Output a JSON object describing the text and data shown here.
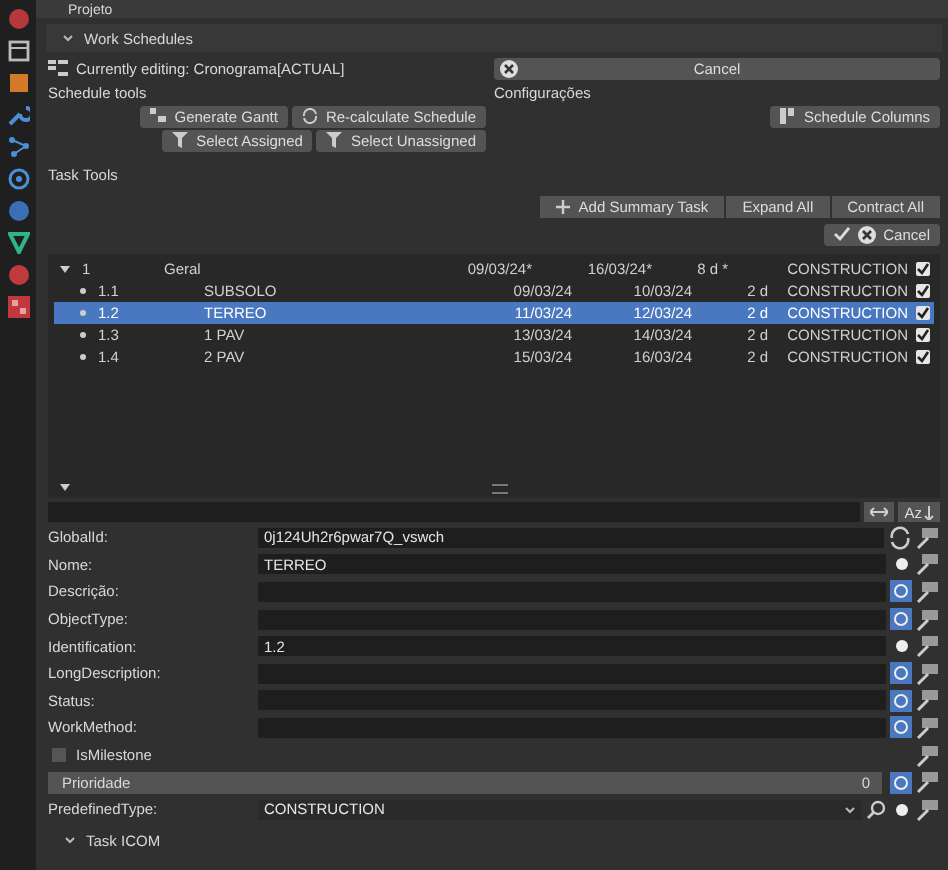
{
  "panel": {
    "title": "Projeto"
  },
  "work_schedules": {
    "title": "Work Schedules",
    "expanded": true,
    "editing": "Currently editing: Cronograma[ACTUAL]",
    "cancel": "Cancel",
    "schedule_tools_label": "Schedule tools",
    "settings_label": "Configurações",
    "tool_buttons": [
      "Generate Gantt",
      "Re-calculate Schedule"
    ],
    "select_buttons": [
      "Select Assigned",
      "Select Unassigned"
    ],
    "schedule_columns": "Schedule Columns",
    "task_tools_label": "Task Tools",
    "task_buttons": [
      "Add Summary Task",
      "Expand All",
      "Contract All"
    ],
    "task_cancel": "Cancel"
  },
  "tasks": [
    {
      "id": "1",
      "name": "Geral",
      "start": "09/03/24*",
      "finish": "16/03/24*",
      "duration": "8 d *",
      "type": "CONSTRUCTION",
      "checked": true,
      "expanded": true,
      "selected": false,
      "children": [
        {
          "id": "1.1",
          "name": "SUBSOLO",
          "start": "09/03/24",
          "finish": "10/03/24",
          "duration": "2 d",
          "type": "CONSTRUCTION",
          "checked": true,
          "selected": false
        },
        {
          "id": "1.2",
          "name": "TERREO",
          "start": "11/03/24",
          "finish": "12/03/24",
          "duration": "2 d",
          "type": "CONSTRUCTION",
          "checked": true,
          "selected": true
        },
        {
          "id": "1.3",
          "name": "1 PAV",
          "start": "13/03/24",
          "finish": "14/03/24",
          "duration": "2 d",
          "type": "CONSTRUCTION",
          "checked": true,
          "selected": false
        },
        {
          "id": "1.4",
          "name": "2 PAV",
          "start": "15/03/24",
          "finish": "16/03/24",
          "duration": "2 d",
          "type": "CONSTRUCTION",
          "checked": true,
          "selected": false
        }
      ]
    }
  ],
  "sort_label": "Az",
  "attributes": [
    {
      "kind": "regenerate",
      "label": "GlobalId:",
      "value": "0j124Uh2r6pwar7Q_vswch"
    },
    {
      "kind": "text",
      "label": "Nome:",
      "value": "TERREO",
      "is_null": false
    },
    {
      "kind": "text",
      "label": "Descrição:",
      "is_null": true
    },
    {
      "kind": "text",
      "label": "ObjectType:",
      "is_null": true
    },
    {
      "kind": "text",
      "label": "Identification:",
      "value": "1.2",
      "is_null": false
    },
    {
      "kind": "text",
      "label": "LongDescription:",
      "is_null": true
    },
    {
      "kind": "text",
      "label": "Status:",
      "is_null": true
    },
    {
      "kind": "text",
      "label": "WorkMethod:",
      "is_null": true
    },
    {
      "kind": "checkbox",
      "label": "IsMilestone",
      "checked": false
    },
    {
      "kind": "number",
      "label": "Prioridade",
      "value": "0",
      "is_null": true
    },
    {
      "kind": "enum",
      "label": "PredefinedType:",
      "value": "CONSTRUCTION",
      "is_null": false
    }
  ],
  "task_icom": {
    "title": "Task ICOM",
    "expanded": true
  }
}
